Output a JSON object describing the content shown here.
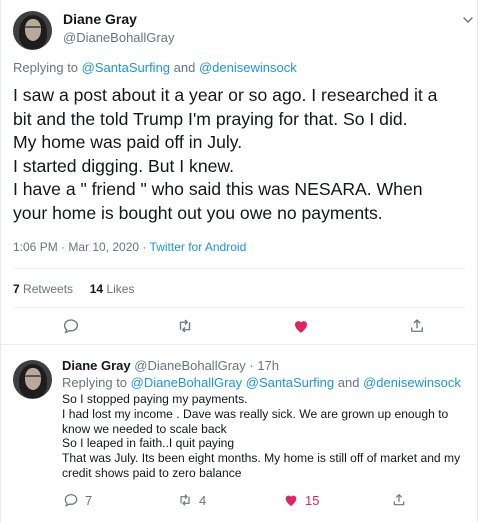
{
  "main_tweet": {
    "author": {
      "name": "Diane Gray",
      "handle": "@DianeBohallGray"
    },
    "replying": {
      "prefix": "Replying to",
      "mention1": "@SantaSurfing",
      "joiner": "and",
      "mention2": "@denisewinsock"
    },
    "text_lines": [
      "I saw a post about it a year or so ago. I researched it a",
      "bit and the told Trump I'm praying for that. So I did.",
      "My home was paid off in July.",
      "I started digging. But I knew.",
      "I have a \" friend \" who said this was NESARA. When",
      "your home is bought out you owe no payments."
    ],
    "meta": {
      "time": "1:06 PM · Mar 10, 2020 ·",
      "source": "Twitter for Android"
    },
    "stats": {
      "retweets_count": "7",
      "retweets_label": "Retweets",
      "likes_count": "14",
      "likes_label": "Likes"
    },
    "icons": [
      "reply-icon",
      "retweet-icon",
      "like-icon",
      "share-icon"
    ],
    "liked": true
  },
  "reply_tweet": {
    "author": {
      "name": "Diane Gray",
      "handle": "@DianeBohallGray",
      "time": "· 17h"
    },
    "replying": {
      "prefix": "Replying to",
      "mention1": "@DianeBohallGray",
      "mention2": "@SantaSurfing",
      "joiner": "and",
      "mention3": "@denisewinsock"
    },
    "text_lines": [
      "So I stopped paying my payments.",
      "I had lost my income . Dave was really sick. We are grown up enough to",
      "know we needed to scale back",
      "So I leaped in faith..I quit paying",
      "That was July. Its been eight months. My home is still off of market and my",
      "credit shows paid to zero balance"
    ],
    "counts": {
      "replies": "7",
      "retweets": "4",
      "likes": "15"
    },
    "liked": true
  },
  "colors": {
    "accent": "#1b95e0",
    "like": "#e0245e",
    "muted": "#657786",
    "text": "#14171a",
    "border": "#e6ecf0"
  }
}
